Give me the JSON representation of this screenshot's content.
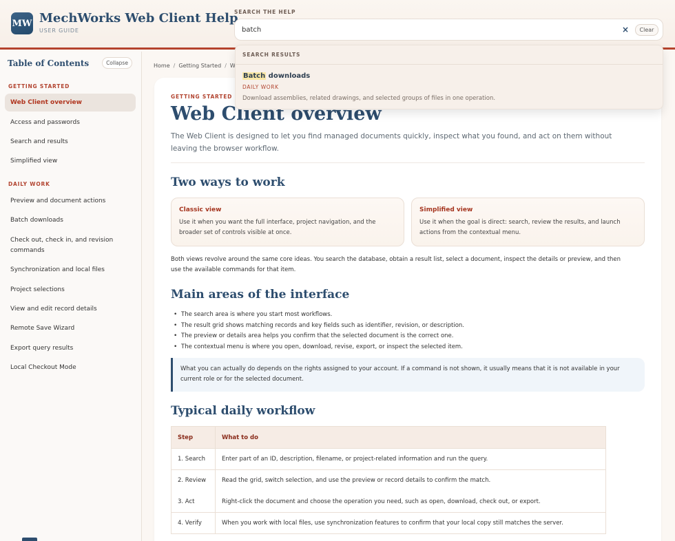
{
  "header": {
    "logo_text": "MW",
    "title": "MechWorks Web Client Help",
    "subtitle": "USER GUIDE",
    "search_label": "SEARCH THE HELP",
    "search_value": "batch",
    "clear_label": "Clear",
    "clear_icon": "×"
  },
  "search_results": {
    "header": "SEARCH RESULTS",
    "items": [
      {
        "title_match": "Batch",
        "title_rest": " downloads",
        "category": "DAILY WORK",
        "description": "Download assemblies, related drawings, and selected groups of files in one operation."
      }
    ]
  },
  "sidebar": {
    "title": "Table of Contents",
    "collapse_label": "Collapse",
    "sections": [
      {
        "label": "GETTING STARTED",
        "items": [
          "Web Client overview",
          "Access and passwords",
          "Search and results",
          "Simplified view"
        ]
      },
      {
        "label": "DAILY WORK",
        "items": [
          "Preview and document actions",
          "Batch downloads",
          "Check out, check in, and revision commands",
          "Synchronization and local files",
          "Project selections",
          "View and edit record details",
          "Remote Save Wizard",
          "Export query results",
          "Local Checkout Mode"
        ]
      }
    ],
    "active_item": "Web Client overview"
  },
  "breadcrumb": [
    "Home",
    "Getting Started",
    "W"
  ],
  "main": {
    "kicker": "GETTING STARTED",
    "title": "Web Client overview",
    "lead": "The Web Client is designed to let you find managed documents quickly, inspect what you found, and act on them without leaving the browser workflow.",
    "section_two_ways": "Two ways to work",
    "views": [
      {
        "title": "Classic view",
        "text": "Use it when you want the full interface, project navigation, and the broader set of controls visible at once."
      },
      {
        "title": "Simplified view",
        "text": "Use it when the goal is direct: search, review the results, and launch actions from the contextual menu."
      }
    ],
    "views_summary": "Both views revolve around the same core ideas. You search the database, obtain a result list, select a document, inspect the details or preview, and then use the available commands for that item.",
    "section_areas": "Main areas of the interface",
    "areas": [
      "The search area is where you start most workflows.",
      "The result grid shows matching records and key fields such as identifier, revision, or description.",
      "The preview or details area helps you confirm that the selected document is the correct one.",
      "The contextual menu is where you open, download, revise, export, or inspect the selected item."
    ],
    "callout": "What you can actually do depends on the rights assigned to your account. If a command is not shown, it usually means that it is not available in your current role or for the selected document.",
    "section_workflow": "Typical daily workflow",
    "workflow_headers": [
      "Step",
      "What to do"
    ],
    "workflow": [
      {
        "step": "1. Search",
        "text": "Enter part of an ID, description, filename, or project-related information and run the query."
      },
      {
        "step": "2. Review",
        "text": "Read the grid, switch selection, and use the preview or record details to confirm the match."
      },
      {
        "step": "3. Act",
        "text": "Right-click the document and choose the operation you need, such as open, download, check out, or export."
      },
      {
        "step": "4. Verify",
        "text": "When you work with local files, use synchronization features to confirm that your local copy still matches the server."
      }
    ]
  },
  "colors": {
    "brand_blue": "#2d4d6e",
    "accent_red": "#b24430",
    "highlight": "#f9e7a6"
  }
}
